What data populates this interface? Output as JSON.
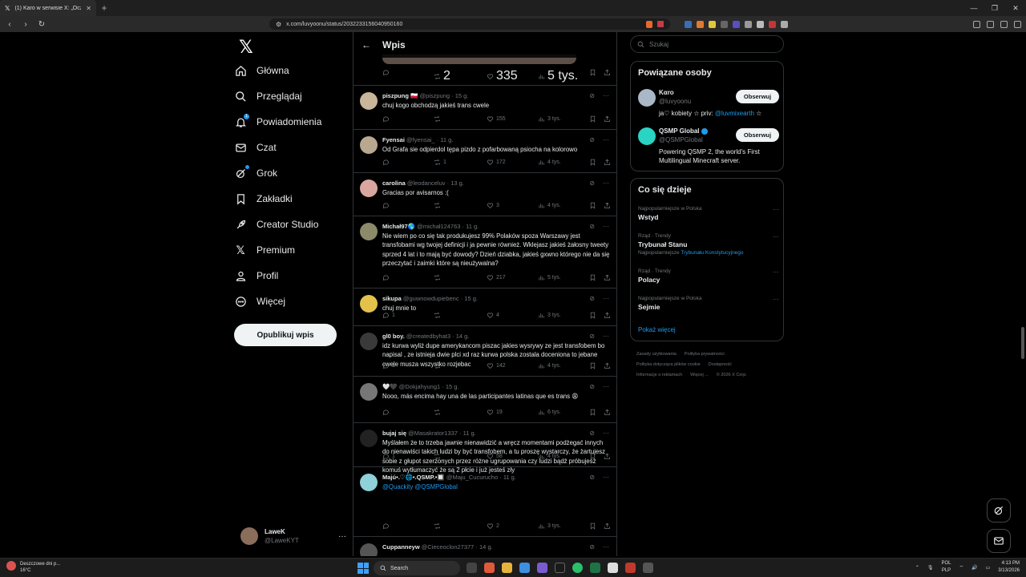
{
  "browser": {
    "tab_title": "(1) Karo w serwisie X: „Oczywiś...",
    "url": "x.com/luvyoonu/status/2032233156040950160",
    "window_controls": [
      "—",
      "❐",
      "✕"
    ]
  },
  "nav": {
    "items": [
      {
        "label": "Główna",
        "icon": "home-icon"
      },
      {
        "label": "Przeglądaj",
        "icon": "search-icon"
      },
      {
        "label": "Powiadomienia",
        "icon": "bell-icon",
        "badge": "1"
      },
      {
        "label": "Czat",
        "icon": "mail-icon"
      },
      {
        "label": "Grok",
        "icon": "grok-icon"
      },
      {
        "label": "Zakładki",
        "icon": "bookmark-icon"
      },
      {
        "label": "Creator Studio",
        "icon": "rocket-icon"
      },
      {
        "label": "Premium",
        "icon": "x-logo-icon"
      },
      {
        "label": "Profil",
        "icon": "person-icon"
      },
      {
        "label": "Więcej",
        "icon": "more-circle-icon"
      }
    ],
    "post_button": "Opublikuj wpis",
    "account": {
      "name": "LaweK",
      "handle": "@LaweKYT"
    }
  },
  "header": {
    "title": "Wpis"
  },
  "prev_stats": {
    "reposts": "2",
    "likes": "335",
    "views": "5 tys."
  },
  "replies": [
    {
      "name": "piszpung 🇵🇱",
      "handle": "@piszpung",
      "time": "15 g.",
      "text": "chuj kogo obchodzą jakieś trans cwele",
      "replies": "",
      "reposts": "",
      "likes": "155",
      "views": "3 tys.",
      "avatar_color": "#c9b59a"
    },
    {
      "name": "Fyensai",
      "handle": "@fyensai_",
      "time": "11 g.",
      "text": "Od Grafa sie odpierdol tępa pizdo z pofarbowaną psiocha na kolorowo",
      "replies": "",
      "reposts": "1",
      "likes": "172",
      "views": "4 tys.",
      "avatar_color": "#b8a88f"
    },
    {
      "name": "carolina",
      "handle": "@leodanceluv",
      "time": "13 g.",
      "text": "Gracias por avisarnos :(",
      "replies": "",
      "reposts": "",
      "likes": "3",
      "views": "4 tys.",
      "avatar_color": "#d9a7a0"
    },
    {
      "name": "Michał97🌎",
      "handle": "@michał124763",
      "time": "11 g.",
      "text": "Nie wiem po co się tak produkujesz 99% Polaków spoza Warszawy jest transfobami wg twojej definicji i ja pewnie również. Wklejasz jakieś żałosny tweety sprzed 4 lat i to mają być dowody? Dzień dziabka, jakieś gxwno którego nie da się przeczytać i zaimki które są nieużywalna?",
      "replies": "",
      "reposts": "",
      "likes": "217",
      "views": "5 tys.",
      "avatar_color": "#8c8a6a"
    },
    {
      "name": "sikupa",
      "handle": "@guwnowdupiebenc",
      "time": "15 g.",
      "text": "chuj mnie to",
      "replies": "1",
      "reposts": "",
      "likes": "4",
      "views": "3 tys.",
      "avatar_color": "#e2c24a"
    },
    {
      "name": "gl0 boy.",
      "handle": "@createdbyhat3",
      "time": "14 g.",
      "text": "idz kurwa wyliż dupe amerykancom piszac jakies wysrywy ze jest transfobem bo napisal , ze istnieja dwie plci xd raz kurwa polska zostala doceniona to jebane cwele musza wszystko rozjebac",
      "replies": "1",
      "reposts": "",
      "likes": "142",
      "views": "4 tys.",
      "avatar_color": "#3a3a3a"
    },
    {
      "name": "🤍🖤",
      "handle": "@Dokjahyung1",
      "time": "15 g.",
      "text": "Nooo, más encima hay una de las participantes latinas que es trans 😩",
      "replies": "",
      "reposts": "",
      "likes": "19",
      "views": "6 tys.",
      "avatar_color": "#777"
    },
    {
      "name": "bujaj się",
      "handle": "@Masakrator1337",
      "time": "11 g.",
      "text": "Myślałem że to trzeba jawnie nienawidzić a wręcz momentami podżegać innych do nienawiści takich ludzi by być transfobem, a tu proszę wystarczy, że żartujesz sobie z głupot szerzonych przez różne ugrupowania czy ludzi bądź próbujesz komuś wytłumaczyć że są 2 płcie i już jesteś zły",
      "replies": "1",
      "reposts": "",
      "likes": "58",
      "views": "4 tys.",
      "avatar_color": "#222"
    },
    {
      "name": "Majú•.♡🌐•.QSMP.•🔲",
      "handle": "@Maju_Cucurucho",
      "time": "11 g.",
      "text": "@Quackity @QSMPGlobal",
      "replies": "",
      "reposts": "",
      "likes": "2",
      "views": "3 tys.",
      "avatar_color": "#8fd0d9"
    },
    {
      "name": "Cuppanneyw",
      "handle": "@Cieceoclon27377",
      "time": "14 g.",
      "text": "",
      "replies": "",
      "reposts": "",
      "likes": "",
      "views": "",
      "avatar_color": "#555"
    }
  ],
  "right": {
    "search_placeholder": "Szukaj",
    "related_title": "Powiązane osoby",
    "people": [
      {
        "name": "Kαro",
        "handle": "@luvyoonu",
        "desc": "ja♡ kobiety ☆ priv: ",
        "desc_mention": "@luvmixearth",
        "desc_tail": " ☆",
        "follow": "Obserwuj",
        "avatar_color": "#a9b7c6"
      },
      {
        "name": "QSMP Global",
        "handle": "@QSMPGlobal",
        "desc": "Powering QSMP 2, the world's First Multilingual Minecraft server.",
        "desc_mention": "",
        "desc_tail": "",
        "follow": "Obserwuj",
        "avatar_color": "#2ad4c4"
      }
    ],
    "trends_title": "Co się dzieje",
    "trends": [
      {
        "context": "Najpopularniejsze w Polska",
        "title": "Wstyd",
        "sub": "",
        "sub_mention": ""
      },
      {
        "context": "Rząd · Trendy",
        "title": "Trybunał Stanu",
        "sub": "Najpopularniejsze ",
        "sub_mention": "Trybunału Konstytucyjnego"
      },
      {
        "context": "Rząd · Trendy",
        "title": "Polacy",
        "sub": "",
        "sub_mention": ""
      },
      {
        "context": "Najpopularniejsze w Polska",
        "title": "Sejmie",
        "sub": "",
        "sub_mention": ""
      }
    ],
    "show_more": "Pokaż więcej",
    "footer": [
      "Zasady użytkowania",
      "Polityka prywatności",
      "Polityka dotycząca plików cookie",
      "Dostępność",
      "Informacje o reklamach",
      "Więcej ...",
      "© 2026 X Corp."
    ]
  },
  "taskbar": {
    "weather_title": "Deszczowe dni p...",
    "weather_temp": "16°C",
    "search": "Search",
    "lang_top": "POL",
    "lang_bottom": "PLP",
    "time": "4:13 PM",
    "date": "3/13/2026"
  }
}
